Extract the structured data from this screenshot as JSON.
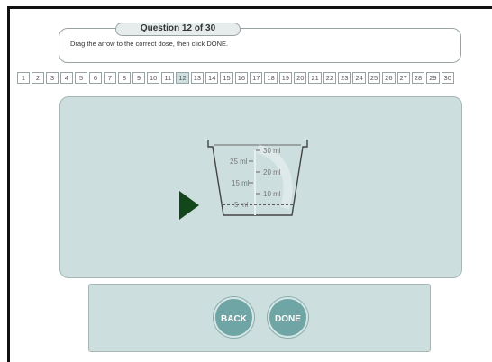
{
  "header": {
    "question_label": "Question 12 of 30",
    "instruction": "Drag the arrow to the correct dose, then click DONE."
  },
  "question_numbers": [
    "1",
    "2",
    "3",
    "4",
    "5",
    "6",
    "7",
    "8",
    "9",
    "10",
    "11",
    "12",
    "13",
    "14",
    "15",
    "16",
    "17",
    "18",
    "19",
    "20",
    "21",
    "22",
    "23",
    "24",
    "25",
    "26",
    "27",
    "28",
    "29",
    "30"
  ],
  "current_question": "12",
  "cup": {
    "right_marks": [
      "30 ml",
      "20 ml",
      "10 ml"
    ],
    "left_marks": [
      "25 ml",
      "15 ml",
      "5 ml"
    ]
  },
  "buttons": {
    "back": "BACK",
    "done": "DONE"
  },
  "colors": {
    "panel": "#cddede",
    "button": "#6fa5a5",
    "arrow": "#14461c"
  }
}
